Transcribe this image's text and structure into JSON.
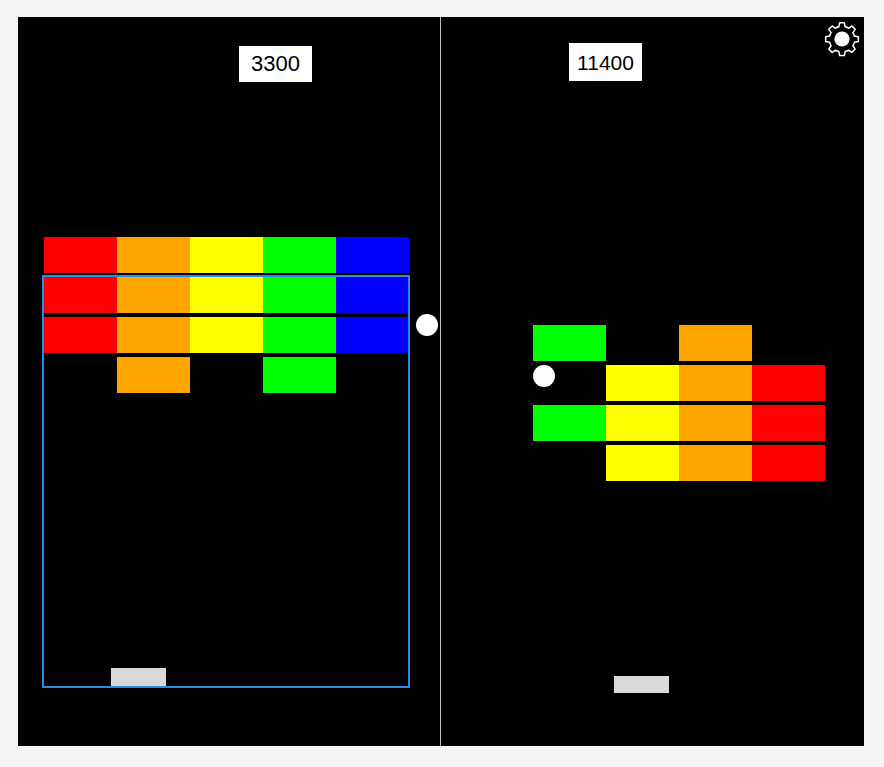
{
  "panels": [
    {
      "score": "3300",
      "selected": true,
      "bricks": [
        [
          "#ff0000",
          "#ffa500",
          "#ffff00",
          "#00ff00",
          "#0000ff"
        ],
        [
          "#ff0000",
          "#ffa500",
          "#ffff00",
          "#00ff00",
          "#0000ff"
        ],
        [
          "#ff0000",
          "#ffa500",
          "#ffff00",
          "#00ff00",
          "#0000ff"
        ],
        [
          null,
          "#ffa500",
          null,
          "#00ff00",
          null
        ]
      ]
    },
    {
      "score": "11400",
      "selected": false,
      "bricks": [
        [
          "#00ff00",
          null,
          "#ffa500",
          null
        ],
        [
          null,
          "#ffff00",
          "#ffa500",
          "#ff0000"
        ],
        [
          "#00ff00",
          "#ffff00",
          "#ffa500",
          "#ff0000"
        ],
        [
          null,
          "#ffff00",
          "#ffa500",
          "#ff0000"
        ]
      ]
    }
  ]
}
